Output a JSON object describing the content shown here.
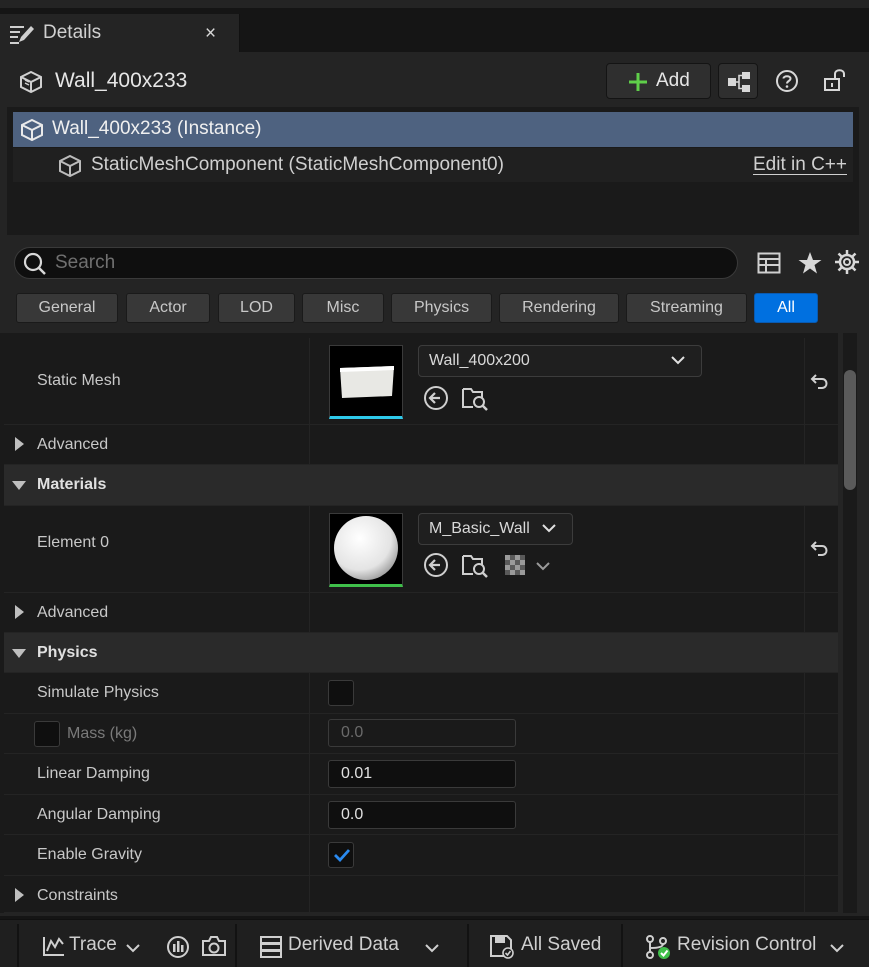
{
  "tab": {
    "title": "Details",
    "close": "×"
  },
  "header": {
    "actor_name": "Wall_400x233",
    "add_label": "Add"
  },
  "tree": {
    "instance": "Wall_400x233 (Instance)",
    "component": "StaticMeshComponent (StaticMeshComponent0)",
    "edit_link": "Edit in C++"
  },
  "search": {
    "placeholder": "Search"
  },
  "filters": [
    "General",
    "Actor",
    "LOD",
    "Misc",
    "Physics",
    "Rendering",
    "Streaming",
    "All"
  ],
  "active_filter": "All",
  "properties": {
    "static_mesh": {
      "label": "Static Mesh",
      "value": "Wall_400x200"
    },
    "advanced_1": "Advanced",
    "materials_category": "Materials",
    "element0": {
      "label": "Element 0",
      "value": "M_Basic_Wall"
    },
    "advanced_2": "Advanced",
    "physics_category": "Physics",
    "simulate_physics": {
      "label": "Simulate Physics",
      "checked": false
    },
    "mass": {
      "label": "Mass (kg)",
      "value": "0.0",
      "enabled": false
    },
    "linear_damping": {
      "label": "Linear Damping",
      "value": "0.01"
    },
    "angular_damping": {
      "label": "Angular Damping",
      "value": "0.0"
    },
    "enable_gravity": {
      "label": "Enable Gravity",
      "checked": true
    },
    "constraints": "Constraints"
  },
  "status_bar": {
    "trace": "Trace",
    "derived_data": "Derived Data",
    "all_saved": "All Saved",
    "revision_control": "Revision Control"
  },
  "colors": {
    "accent": "#0070e0",
    "selected_row": "#4e6280",
    "add_plus": "#5fcf4a",
    "mesh_underline": "#2ec9ea",
    "material_underline": "#3fbf4a"
  }
}
